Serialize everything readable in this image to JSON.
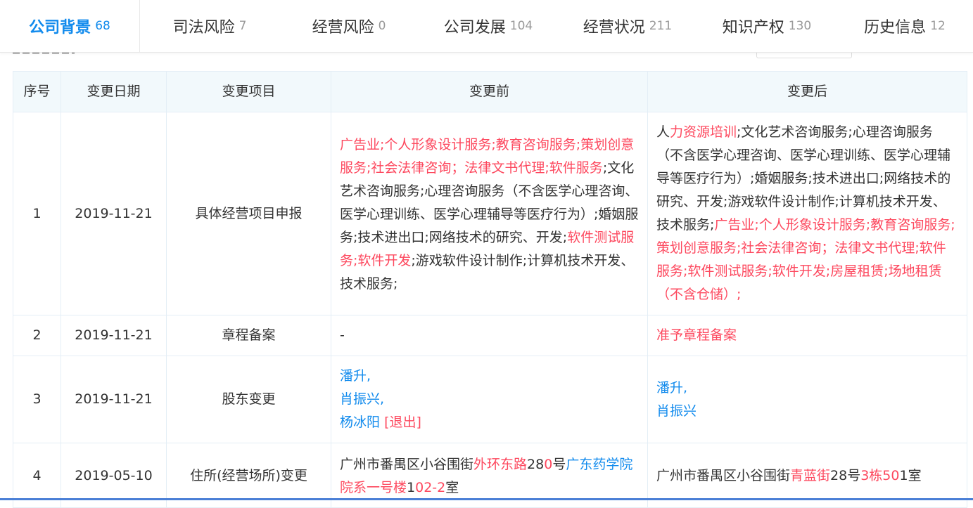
{
  "tabs": [
    {
      "label": "公司背景",
      "count": "68"
    },
    {
      "label": "司法风险",
      "count": "7"
    },
    {
      "label": "经营风险",
      "count": "0"
    },
    {
      "label": "公司发展",
      "count": "104"
    },
    {
      "label": "经营状况",
      "count": "211"
    },
    {
      "label": "知识产权",
      "count": "130"
    },
    {
      "label": "历史信息",
      "count": "12"
    }
  ],
  "table": {
    "headers": [
      "序号",
      "变更日期",
      "变更项目",
      "变更前",
      "变更后"
    ],
    "rows": [
      {
        "index": "1",
        "date": "2019-11-21",
        "item": "具体经营项目申报",
        "before": [
          {
            "t": "广告业;个人形象设计服务;教育咨询服务;策划创意服务;社会法律咨询；法律文书代理;软件服务",
            "h": true
          },
          {
            "t": ";文化艺术咨询服务;心理咨询服务（不含医学心理咨询、医学心理训练、医学心理辅导等医疗行为）;婚姻服务;技术进出口;网络技术的研究、开发;",
            "h": false
          },
          {
            "t": "软件测试服务;软件开发",
            "h": true
          },
          {
            "t": ";游戏软件设计制作;计算机技术开发、技术服务;",
            "h": false
          }
        ],
        "after": [
          {
            "t": "人",
            "h": false
          },
          {
            "t": "力资源培训",
            "h": true
          },
          {
            "t": ";文化艺术咨询服务;心理咨询服务（不含医学心理咨询、医学心理训练、医学心理辅导等医疗行为）;婚姻服务;技术进出口;网络技术的研究、开发;游戏软件设计制作;计算机技术开发、技术服务;",
            "h": false
          },
          {
            "t": "广告业;个人形象设计服务;教育咨询服务;策划创意服务;社会法律咨询；法律文书代理;软件服务;软件测试服务;软件开发;房屋租赁;场地租赁（不含仓储）;",
            "h": true
          }
        ]
      },
      {
        "index": "2",
        "date": "2019-11-21",
        "item": "章程备案",
        "before_text": "-",
        "after_text": "准予章程备案"
      },
      {
        "index": "3",
        "date": "2019-11-21",
        "item": "股东变更",
        "before_lines": [
          "潘升,",
          "肖振兴,",
          "杨冰阳"
        ],
        "exit_label": "[退出]",
        "after_lines": [
          "潘升,",
          "肖振兴"
        ]
      },
      {
        "index": "4",
        "date": "2019-05-10",
        "item": "住所(经营场所)变更",
        "before": [
          {
            "t": "广州市番禺区小谷围街",
            "h": false
          },
          {
            "t": "外环东路",
            "h": true
          },
          {
            "t": "28",
            "h": false
          },
          {
            "t": "0",
            "h": true
          },
          {
            "t": "号",
            "h": false
          },
          {
            "t": "广东药学院",
            "h": "l"
          },
          {
            "t": "院系一号楼",
            "h": true
          },
          {
            "t": "1",
            "h": false
          },
          {
            "t": "02-2",
            "h": true
          },
          {
            "t": "室",
            "h": false
          }
        ],
        "after": [
          {
            "t": "广州市番禺区小谷围街",
            "h": false
          },
          {
            "t": "青蓝街",
            "h": true
          },
          {
            "t": "28号",
            "h": false
          },
          {
            "t": "3栋50",
            "h": true
          },
          {
            "t": "1室",
            "h": false
          }
        ]
      }
    ]
  }
}
